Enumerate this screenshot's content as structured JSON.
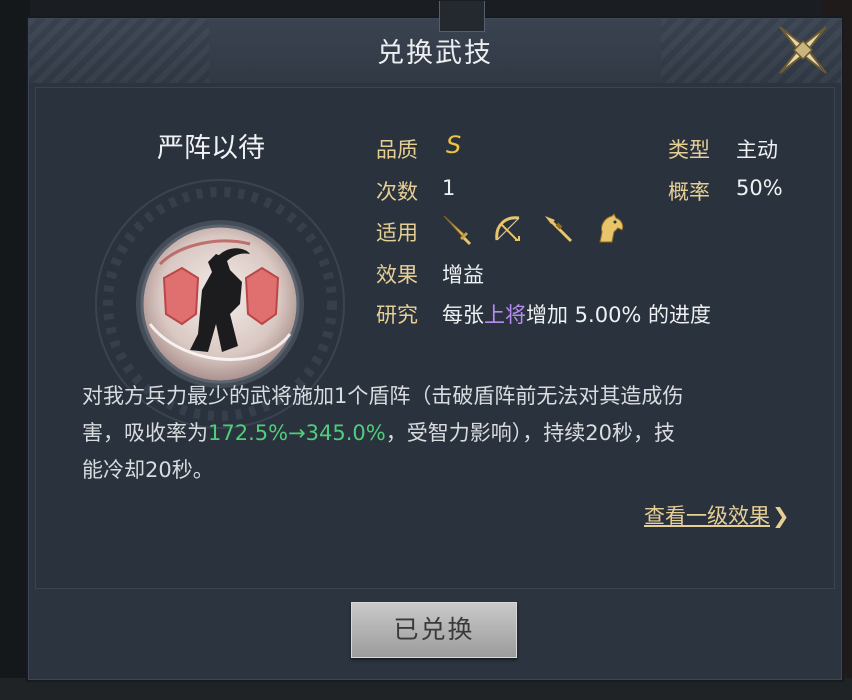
{
  "dialog": {
    "title": "兑换武技",
    "close_icon": "close-x-icon"
  },
  "skill": {
    "name": "严阵以待",
    "icon": "shield-warrior-icon",
    "quality_label": "品质",
    "quality_value": "S",
    "type_label": "类型",
    "type_value": "主动",
    "count_label": "次数",
    "count_value": "1",
    "rate_label": "概率",
    "rate_value": "50%",
    "applicable_label": "适用",
    "applicable_icons": [
      "sword-icon",
      "bow-icon",
      "spear-icon",
      "horse-icon"
    ],
    "effect_label": "效果",
    "effect_value": "增益",
    "research_label": "研究",
    "research_prefix": "每张",
    "research_highlight": "上将",
    "research_suffix": "增加 5.00% 的进度"
  },
  "description": {
    "line1": "对我方兵力最少的武将施加1个盾阵（击破盾阵前无法对其造成伤",
    "line2_prefix": "害，吸收率为",
    "line2_green": "172.5%→345.0%",
    "line2_suffix": "，受智力影响），持续20秒，技",
    "line3": "能冷却20秒。"
  },
  "links": {
    "view_level1": "查看一级效果",
    "view_arrow": "❯"
  },
  "button": {
    "redeemed_label": "已兑换"
  },
  "colors": {
    "label_gold": "#e6cf95",
    "grade_yellow": "#f0c33c",
    "highlight_purple": "#b58cf0",
    "value_green": "#4fcd7a",
    "panel": "#2c3440"
  }
}
